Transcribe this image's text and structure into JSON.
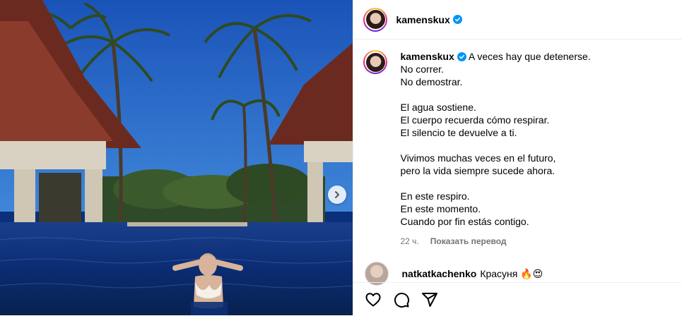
{
  "post": {
    "username": "kamenskux",
    "caption_lines": "A veces hay que detenerse.\nNo correr.\nNo demostrar.\n\nEl agua sostiene.\nEl cuerpo recuerda cómo respirar.\nEl silencio te devuelve a ti.\n\nVivimos muchas veces en el futuro,\npero la vida siempre sucede ahora.\n\nEn este respiro.\nEn este momento.\nCuando por fin estás contigo.",
    "time_ago": "22 ч.",
    "translate_label": "Показать перевод"
  },
  "comment": {
    "username": "natkatkachenko",
    "text": "Красуня 🔥😍"
  },
  "icons": {
    "like": "heart-icon",
    "comment": "comment-icon",
    "share": "share-icon",
    "next": "chevron-right-icon",
    "verified": "verified-badge-icon"
  },
  "colors": {
    "verified": "#0095f6",
    "secondary_text": "#737373"
  }
}
